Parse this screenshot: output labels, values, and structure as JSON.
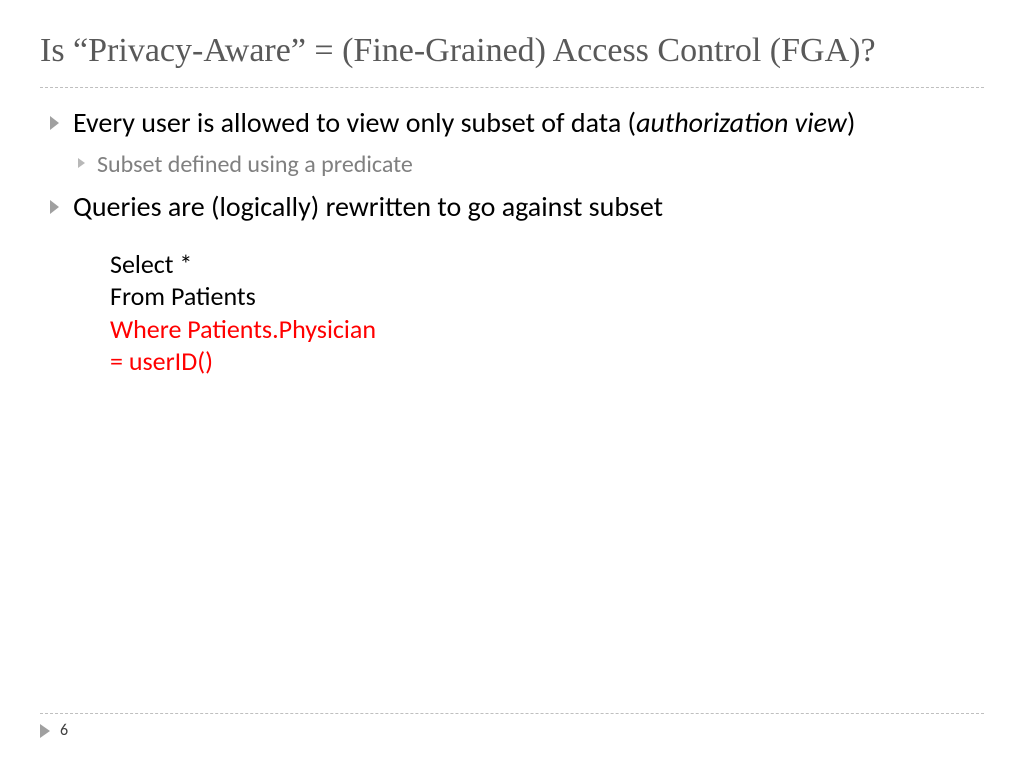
{
  "title": "Is “Privacy-Aware” = (Fine-Grained) Access Control (FGA)?",
  "bullets": {
    "item1_prefix": "Every user is allowed to view only subset of data (",
    "item1_italic": "authorization view",
    "item1_suffix": ")",
    "sub1": "Subset defined using a predicate",
    "item2": "Queries are (logically) rewritten to go against subset"
  },
  "code": {
    "line1": "Select *",
    "line2": "From Patients",
    "line3": "Where Patients.Physician",
    "line4": "= userID()"
  },
  "page_number": "6"
}
